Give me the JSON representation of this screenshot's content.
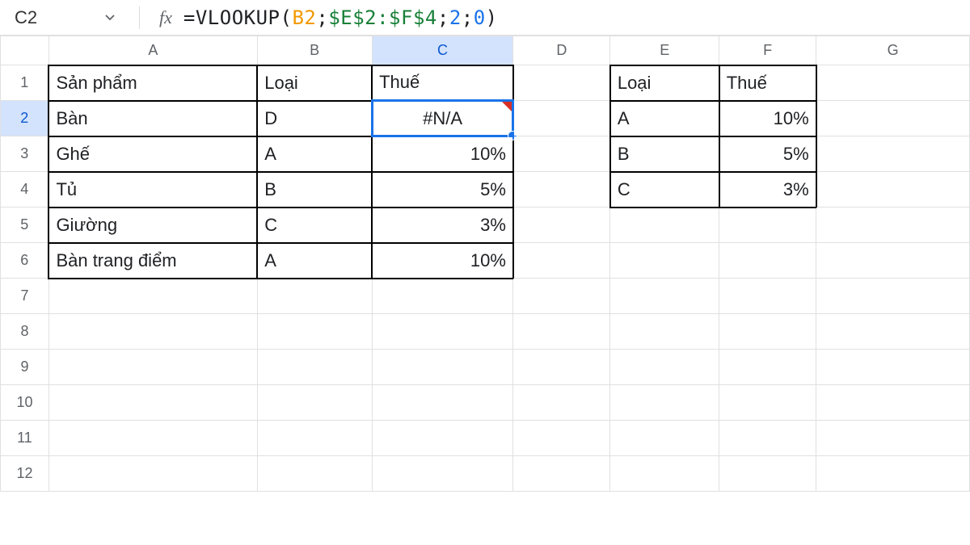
{
  "formula_bar": {
    "cell_ref": "C2",
    "fx_label": "fx",
    "tokens": {
      "eq": "=",
      "fn": "VLOOKUP",
      "lp": "(",
      "arg1": "B2",
      "sep1": ";",
      "arg2": "$E$2:$F$4",
      "sep2": ";",
      "arg3": "2",
      "sep3": ";",
      "arg4": "0",
      "rp": ")"
    }
  },
  "columns": [
    "A",
    "B",
    "C",
    "D",
    "E",
    "F",
    "G"
  ],
  "active_column": "C",
  "active_row": "2",
  "row_count": 12,
  "cells": {
    "A1": "Sản phẩm",
    "B1": "Loại",
    "C1": "Thuế",
    "E1": "Loại",
    "F1": "Thuế",
    "A2": "Bàn",
    "B2": "D",
    "C2": "#N/A",
    "E2": "A",
    "F2": "10%",
    "A3": "Ghế",
    "B3": "A",
    "C3": "10%",
    "E3": "B",
    "F3": "5%",
    "A4": "Tủ",
    "B4": "B",
    "C4": "5%",
    "E4": "C",
    "F4": "3%",
    "A5": "Giường",
    "B5": "C",
    "C5": "3%",
    "A6": "Bàn trang điểm",
    "B6": "A",
    "C6": "10%"
  },
  "selected_cell": "C2",
  "selected_has_error": true,
  "chart_data": {
    "type": "table",
    "main_table": {
      "columns": [
        "Sản phẩm",
        "Loại",
        "Thuế"
      ],
      "rows": [
        [
          "Bàn",
          "D",
          "#N/A"
        ],
        [
          "Ghế",
          "A",
          "10%"
        ],
        [
          "Tủ",
          "B",
          "5%"
        ],
        [
          "Giường",
          "C",
          "3%"
        ],
        [
          "Bàn trang điểm",
          "A",
          "10%"
        ]
      ]
    },
    "lookup_table": {
      "columns": [
        "Loại",
        "Thuế"
      ],
      "rows": [
        [
          "A",
          "10%"
        ],
        [
          "B",
          "5%"
        ],
        [
          "C",
          "3%"
        ]
      ]
    }
  }
}
